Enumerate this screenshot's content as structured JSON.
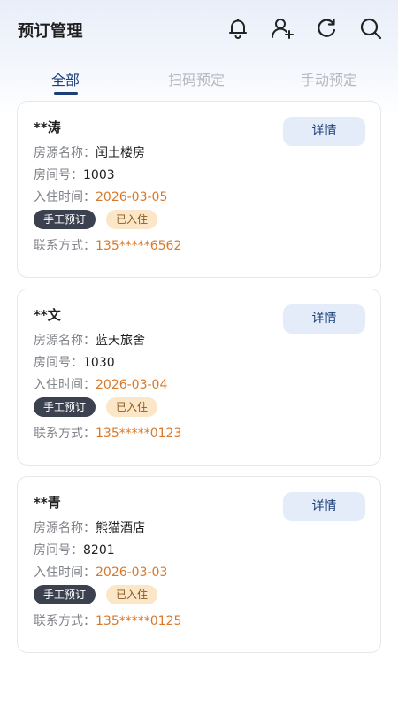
{
  "header": {
    "title": "预订管理",
    "icons": [
      "bell-icon",
      "add-user-icon",
      "refresh-icon",
      "search-icon"
    ]
  },
  "tabs": [
    {
      "label": "全部",
      "active": true
    },
    {
      "label": "扫码预定",
      "active": false
    },
    {
      "label": "手动预定",
      "active": false
    }
  ],
  "labels": {
    "property": "房源名称：",
    "room": "房间号：",
    "checkin": "入住时间：",
    "contact": "联系方式：",
    "detail_button": "详情"
  },
  "bookings": [
    {
      "name": "**涛",
      "property": "闰土楼房",
      "room": "1003",
      "checkin": "2026-03-05",
      "type_badge": "手工预订",
      "status_badge": "已入住",
      "phone": "135*****6562"
    },
    {
      "name": "**文",
      "property": "蓝天旅舍",
      "room": "1030",
      "checkin": "2026-03-04",
      "type_badge": "手工预订",
      "status_badge": "已入住",
      "phone": "135*****0123"
    },
    {
      "name": "**青",
      "property": "熊猫酒店",
      "room": "8201",
      "checkin": "2026-03-03",
      "type_badge": "手工预订",
      "status_badge": "已入住",
      "phone": "135*****0125"
    }
  ],
  "colors": {
    "accent": "#1b3f7a",
    "highlight_value": "#d9782a",
    "type_badge_bg": "#3c4150",
    "status_badge_bg": "#fbe6c8",
    "detail_button_bg": "#e4ecf9"
  }
}
